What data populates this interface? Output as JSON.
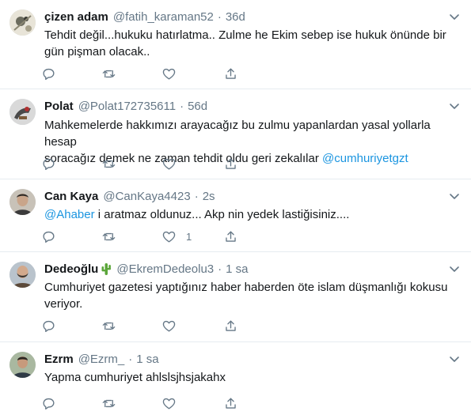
{
  "tweets": [
    {
      "name": "çizen adam",
      "handle": "@fatih_karaman52",
      "separator": "·",
      "time": "36d",
      "text_lines": [
        "Tehdit değil...hukuku hatırlatma.. Zulme he Ekim sebep ise hukuk önünde bir",
        "gün pişman olacak.."
      ],
      "like_count": ""
    },
    {
      "name": "Polat",
      "handle": "@Polat172735611",
      "separator": "·",
      "time": "56d",
      "text_lines": [
        "Mahkemelerde hakkımızı arayacağız bu zulmu yapanlardan yasal yollarla hesap"
      ],
      "text_line2_plain": "soracağız demek ne zaman tehdit oldu geri zekalılar ",
      "text_line2_mention": "@cumhuriyetgzt",
      "like_count": ""
    },
    {
      "name": "Can Kaya",
      "handle": "@CanKaya4423",
      "separator": "·",
      "time": "2s",
      "text_mention": "@Ahaber",
      "text_rest": " i aratmaz oldunuz... Akp nin yedek lastiğisiniz....",
      "like_count": "1"
    },
    {
      "name": "Dedeoğlu",
      "name_emoji": "cactus-emoji",
      "handle": "@EkremDedeolu3",
      "separator": "·",
      "time": "1 sa",
      "text_lines": [
        "Cumhuriyet gazetesi yaptığınız haber haberden öte islam düşmanlığı kokusu",
        "veriyor."
      ],
      "like_count": ""
    },
    {
      "name": "Ezrm",
      "handle": "@Ezrm_",
      "separator": "·",
      "time": "1 sa",
      "text_lines": [
        "Yapma cumhuriyet ahlslsjhsjakahx"
      ],
      "like_count": ""
    }
  ],
  "icons": {
    "reply": "reply-icon",
    "retweet": "retweet-icon",
    "like": "heart-icon",
    "share": "share-icon",
    "caret": "chevron-down-icon"
  },
  "colors": {
    "text": "#14171a",
    "secondary": "#657786",
    "link": "#1b95e0",
    "border": "#e6ecf0"
  }
}
